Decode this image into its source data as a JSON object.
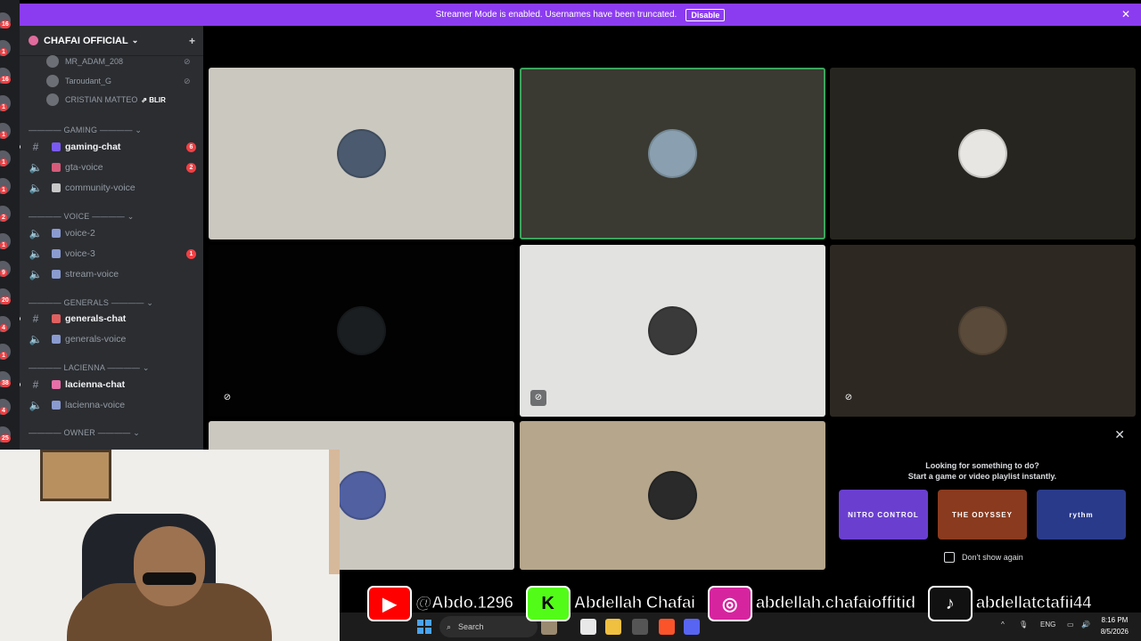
{
  "banner": {
    "message": "Streamer Mode is enabled. Usernames have been truncated.",
    "disable_label": "Disable",
    "close_glyph": "✕",
    "color": "#8c3cf0"
  },
  "server_rail": {
    "badges": [
      "16",
      "1",
      "16",
      "1",
      "1",
      "1",
      "1",
      "2",
      "1",
      "9",
      "20",
      "4",
      "1",
      "38",
      "4",
      "25"
    ]
  },
  "server": {
    "name": "CHAFAI OFFICIAL",
    "chevron_glyph": "⌄",
    "add_member_glyph": "+"
  },
  "voice_users": [
    {
      "name": "MR_ADAM_208",
      "mute_glyph": "⊘"
    },
    {
      "name": "Taroudant_G",
      "mute_glyph": "⊘"
    },
    {
      "name": "CRISTIAN MATTEO",
      "live": "⇗ BLIR",
      "mute_glyph": ""
    }
  ],
  "categories": [
    {
      "label": "———— GAMING ———— ⌄"
    },
    {
      "label": "———— VOICE ———— ⌄"
    },
    {
      "label": "———— GENERALS ———— ⌄"
    },
    {
      "label": "———— LACIENNA ———— ⌄"
    },
    {
      "label": "———— OWNER ———— ⌄"
    }
  ],
  "channels": [
    {
      "name": "gaming-chat",
      "type": "text",
      "unread": true,
      "badge": "6",
      "emoji_color": "#7a5af5"
    },
    {
      "name": "gta-voice",
      "type": "voice",
      "unread": false,
      "badge": "2",
      "emoji_color": "#d65b7a"
    },
    {
      "name": "community-voice",
      "type": "voice",
      "unread": false,
      "badge": "",
      "emoji_color": "#c8c8c8"
    },
    {
      "name": "voice-2",
      "type": "voice",
      "unread": false,
      "badge": "",
      "emoji_color": "#8a9bd0"
    },
    {
      "name": "voice-3",
      "type": "voice",
      "unread": false,
      "badge": "1",
      "emoji_color": "#8a9bd0"
    },
    {
      "name": "stream-voice",
      "type": "voice",
      "unread": false,
      "badge": "",
      "emoji_color": "#8a9bd0"
    },
    {
      "name": "generals-chat",
      "type": "text",
      "unread": true,
      "badge": "",
      "emoji_color": "#e06060"
    },
    {
      "name": "generals-voice",
      "type": "voice",
      "unread": false,
      "badge": "",
      "emoji_color": "#8a9bd0"
    },
    {
      "name": "lacienna-chat",
      "type": "text",
      "unread": true,
      "badge": "",
      "emoji_color": "#e86fa8"
    },
    {
      "name": "lacienna-voice",
      "type": "voice",
      "unread": false,
      "badge": "",
      "emoji_color": "#8a9bd0"
    }
  ],
  "glyphs": {
    "text": "#",
    "voice": "🔈",
    "mic_muted": "⊘"
  },
  "tiles": [
    {
      "bg": "#cbc8c0",
      "avatar": "#4b5a6e",
      "speaking": false,
      "muted": false
    },
    {
      "bg": "#3a3a32",
      "avatar": "#8aa0b0",
      "speaking": true,
      "muted": false
    },
    {
      "bg": "#26251f",
      "avatar": "#e8e6e2",
      "speaking": false,
      "muted": false
    },
    {
      "bg": "#020202",
      "avatar": "#1a1e20",
      "speaking": false,
      "muted": true
    },
    {
      "bg": "#e2e3e1",
      "avatar": "#3a3a3a",
      "speaking": false,
      "muted": true
    },
    {
      "bg": "#2d2822",
      "avatar": "#5a4a3a",
      "speaking": false,
      "muted": true
    },
    {
      "bg": "#cbc8c0",
      "avatar": "#5060a0",
      "speaking": false,
      "muted": false
    },
    {
      "bg": "#b5a68c",
      "avatar": "#2a2a2a",
      "speaking": false,
      "muted": false
    }
  ],
  "activity": {
    "line1": "Looking for something to do?",
    "line2": "Start a game or video playlist instantly.",
    "cards": [
      {
        "label": "NITRO CONTROL",
        "color": "#6a3fd0"
      },
      {
        "label": "THE ODYSSEY",
        "color": "#8a3a1e"
      },
      {
        "label": "rythm",
        "color": "#2a3a8a"
      }
    ],
    "dont_show": "Don't show again",
    "close_glyph": "✕"
  },
  "socials": [
    {
      "glyph": "▶",
      "label": "@Abdo.1296",
      "color": "#ff0000"
    },
    {
      "glyph": "K",
      "label": "Abdellah Chafai",
      "color": "#53fc18"
    },
    {
      "glyph": "◎",
      "label": "abdellah.chafaioffitid",
      "color": "#d6249f"
    },
    {
      "glyph": "♪",
      "label": "abdellatctafii44",
      "color": "#111111"
    }
  ],
  "taskbar": {
    "search_label": "Search",
    "search_glyph": "⌕",
    "lang": "ENG",
    "time": "8:16 PM",
    "date": "8/5/2026",
    "tray_glyphs": [
      "^",
      "🎙",
      "▭",
      "🔊"
    ]
  }
}
